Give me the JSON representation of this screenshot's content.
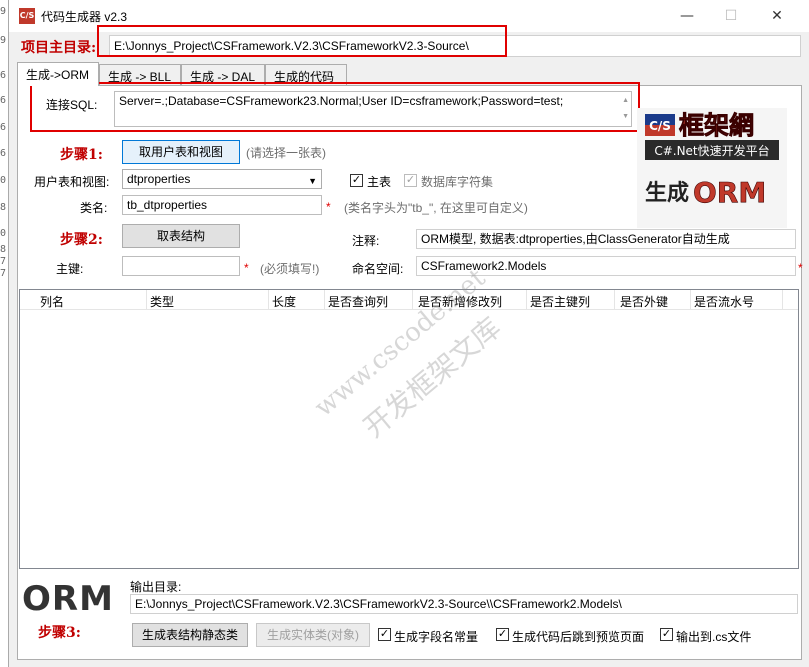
{
  "gutter_digits": [
    "9",
    "9",
    "6",
    "6",
    "6",
    "6",
    "0",
    "8",
    "0",
    "8",
    "7",
    "7"
  ],
  "window": {
    "title": "代码生成器 v2.3",
    "icon_text": "C/S",
    "minimize": "—",
    "maximize": "☐",
    "close": "✕"
  },
  "project": {
    "label": "项目主目录:",
    "path": "E:\\Jonnys_Project\\CSFramework.V2.3\\CSFrameworkV2.3-Source\\"
  },
  "tabs": [
    {
      "label": "生成->ORM",
      "active": true
    },
    {
      "label": "生成 -> BLL"
    },
    {
      "label": "生成 -> DAL"
    },
    {
      "label": "生成的代码"
    }
  ],
  "orm": {
    "conn_label": "连接SQL:",
    "conn_value": "Server=.;Database=CSFramework23.Normal;User ID=csframework;Password=test;",
    "step1_label": "步骤1:",
    "get_tables_button": "取用户表和视图",
    "get_tables_hint": "(请选择一张表)",
    "table_view_label": "用户表和视图:",
    "table_view_value": "dtproperties",
    "pk_checkbox_label": "主表",
    "db_char_checkbox_label": "数据库字符集",
    "class_name_label": "类名:",
    "class_name_value": "tb_dtproperties",
    "class_name_hint": "(类名字头为\"tb_\", 在这里可自定义)",
    "required_mark": "*",
    "step2_label": "步骤2:",
    "get_structure_button": "取表结构",
    "comment_label": "注释:",
    "comment_value": "ORM模型, 数据表:dtproperties,由ClassGenerator自动生成",
    "primary_key_label": "主键:",
    "primary_key_value": "",
    "primary_key_hint": "(必须填写!)",
    "namespace_label": "命名空间:",
    "namespace_value": "CSFramework2.Models",
    "grid_columns": [
      "列名",
      "类型",
      "长度",
      "是否查询列",
      "是否新增修改列",
      "是否主键列",
      "是否外键",
      "是否流水号"
    ],
    "output_dir_label": "输出目录:",
    "output_dir_value": "E:\\Jonnys_Project\\CSFramework.V2.3\\CSFrameworkV2.3-Source\\\\CSFramework2.Models\\",
    "orm_big_text": "ORM",
    "step3_label": "步骤3:",
    "gen_static_button": "生成表结构静态类",
    "gen_entity_button": "生成实体类(对象)",
    "chk_field_const_label": "生成字段名常量",
    "chk_preview_label": "生成代码后跳到预览页面",
    "chk_output_cs_label": "输出到.cs文件"
  },
  "logo": {
    "cs": "C/S",
    "cn_title": "框架網",
    "subtitle": "C#.Net快速开发平台",
    "gen_prefix": "生成",
    "gen_suffix": "ORM"
  },
  "watermark": {
    "line1": "www.cscode.net",
    "line2": "开发框架文库"
  },
  "colors": {
    "accent_red": "#c00000",
    "highlight_box": "#e00000",
    "focus_blue": "#0078d7"
  }
}
